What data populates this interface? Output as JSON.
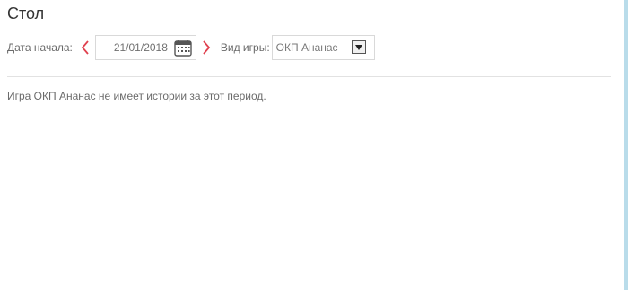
{
  "page": {
    "title": "Стол"
  },
  "filters": {
    "start_date_label": "Дата начала:",
    "start_date_value": "21/01/2018",
    "game_type_label": "Вид игры:",
    "game_type_selected": "ОКП Ананас"
  },
  "icons": {
    "prev": "chevron-left-icon",
    "next": "chevron-right-icon",
    "calendar": "calendar-icon",
    "dropdown": "chevron-down-icon"
  },
  "colors": {
    "arrow_accent": "#e0414f",
    "border": "#d9d9d9",
    "text": "#6a6a6a"
  },
  "message": {
    "text": "Игра ОКП Ананас не имеет истории за этот период."
  }
}
